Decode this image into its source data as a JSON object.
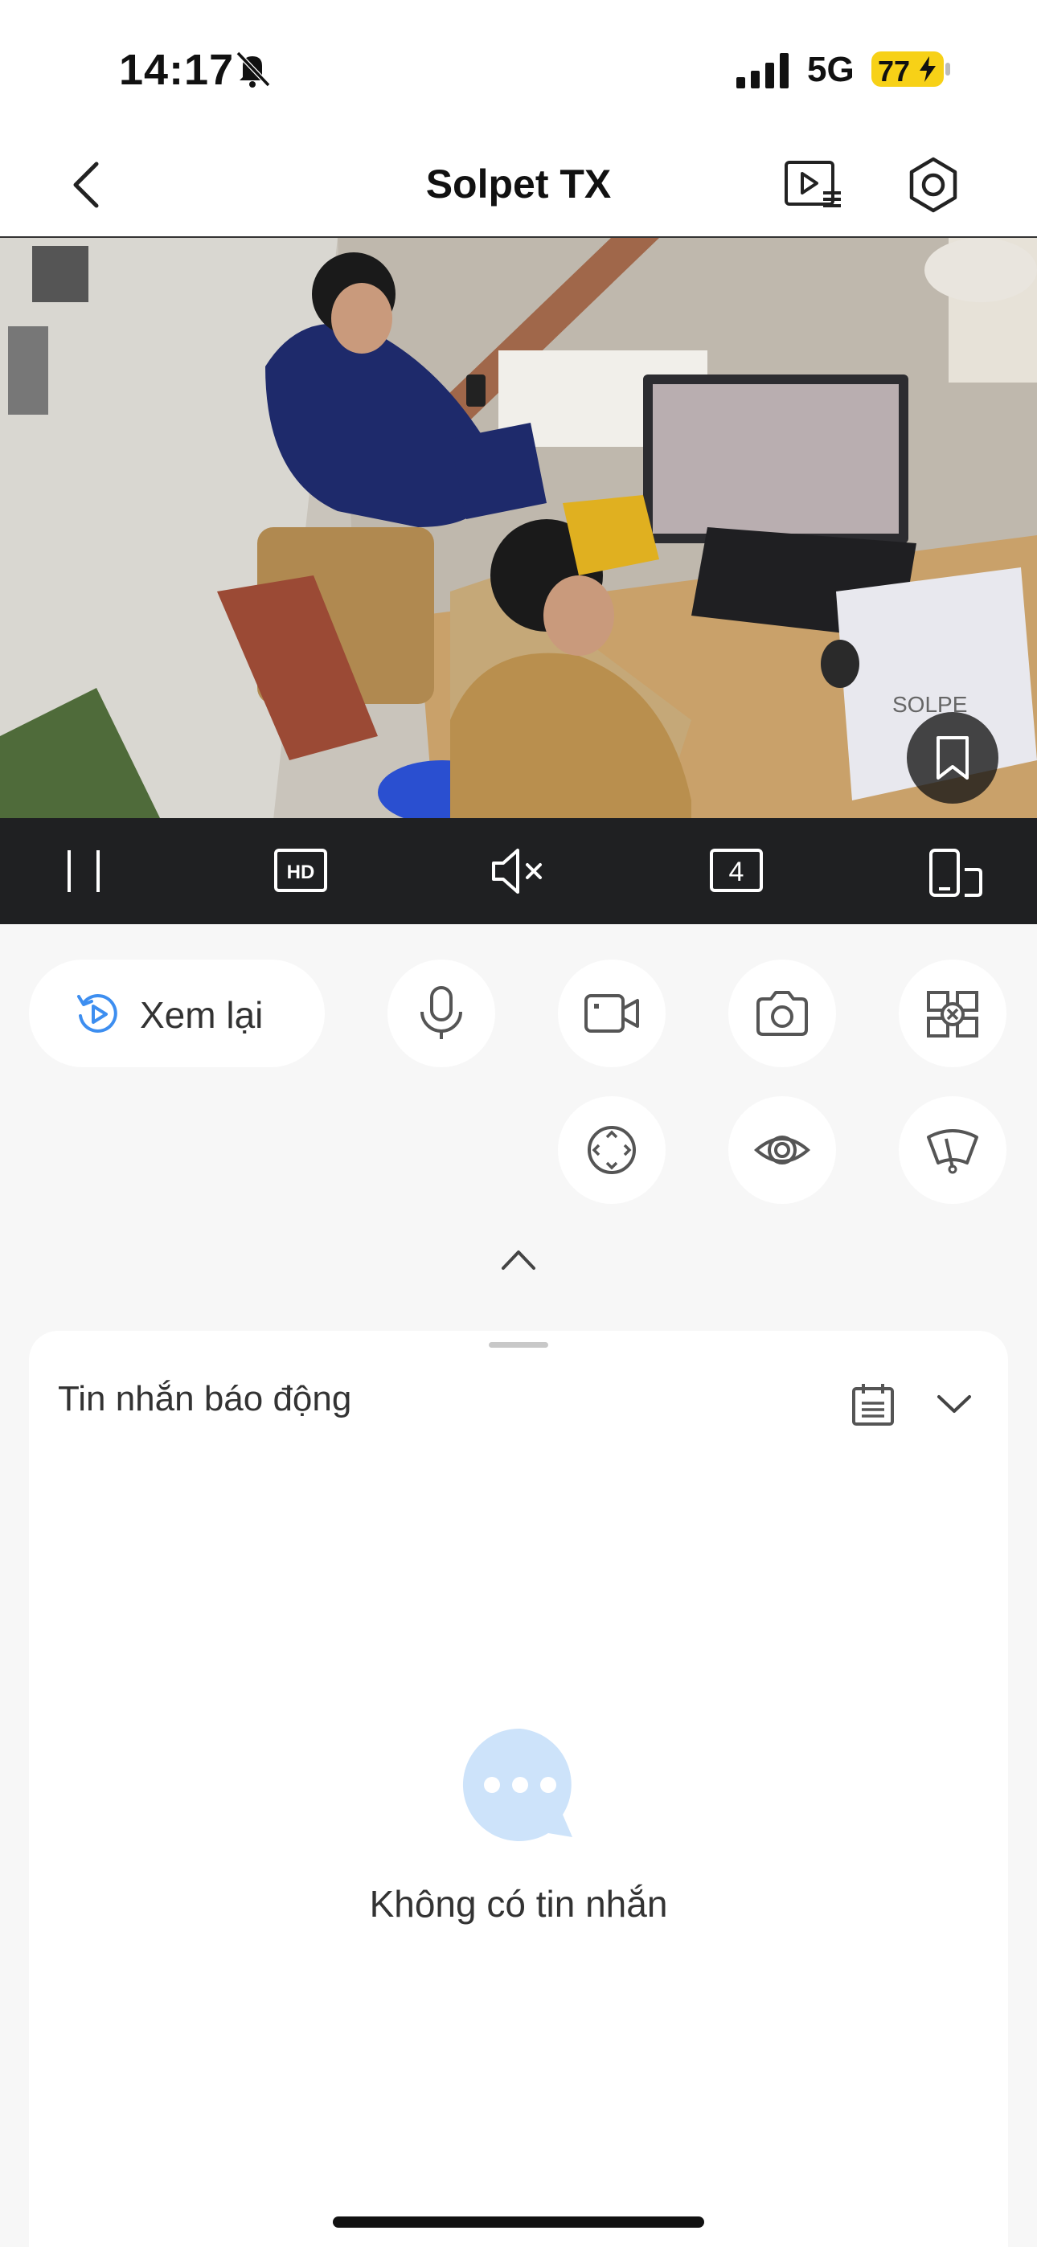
{
  "status_bar": {
    "time": "14:17",
    "network": "5G",
    "battery": "77"
  },
  "nav": {
    "title": "Solpet TX"
  },
  "video": {
    "overlay_text": "SOLPE"
  },
  "toolbar": {
    "hd_label": "HD",
    "split_count": "4"
  },
  "controls": {
    "replay_label": "Xem lại"
  },
  "alarm": {
    "title": "Tin nhắn báo động",
    "empty_text": "Không có tin nhắn"
  },
  "colors": {
    "accent": "#3d8ef0",
    "battery": "#f7d117",
    "toolbar_bg": "#1f2022",
    "empty_bubble": "#cde3fa"
  }
}
